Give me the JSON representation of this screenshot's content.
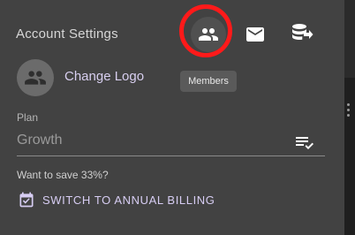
{
  "header": {
    "title": "Account Settings",
    "icons": [
      {
        "name": "members-icon",
        "tooltip": "Members"
      },
      {
        "name": "mail-icon"
      },
      {
        "name": "database-export-icon"
      }
    ],
    "highlight_color": "#ff1a1a"
  },
  "logo": {
    "change_label": "Change Logo",
    "avatar_icon": "group-icon"
  },
  "plan": {
    "label": "Plan",
    "value": "Growth",
    "icon": "list-check-icon"
  },
  "billing": {
    "save_text": "Want to save 33%?",
    "switch_label": "SWITCH TO ANNUAL BILLING",
    "icon": "calendar-check-icon",
    "accent": "#d7cdf3"
  }
}
